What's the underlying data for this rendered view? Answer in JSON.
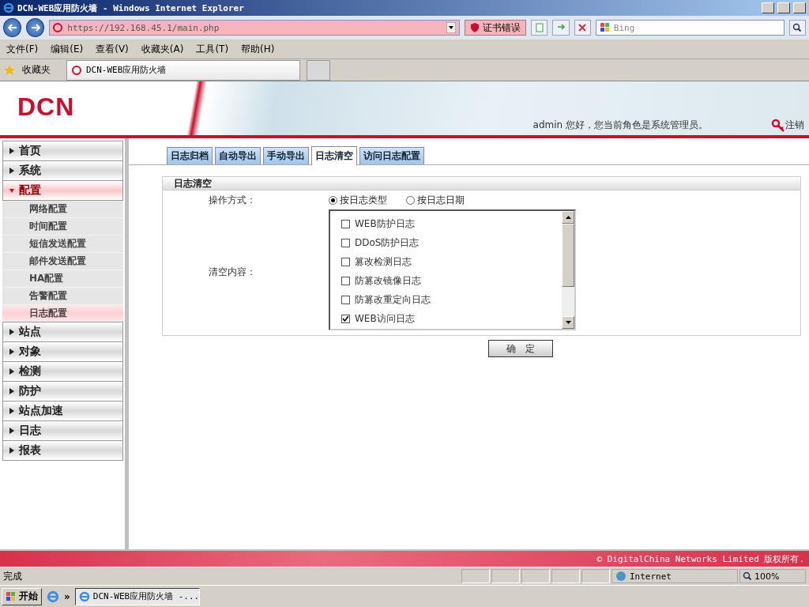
{
  "browser": {
    "title": "DCN-WEB应用防火墙 - Windows Internet Explorer",
    "address": "https://192.168.45.1/main.php",
    "cert_error": "证书错误",
    "search_placeholder": "Bing",
    "menu": [
      "文件(F)",
      "编辑(E)",
      "查看(V)",
      "收藏夹(A)",
      "工具(T)",
      "帮助(H)"
    ],
    "favorites": "收藏夹",
    "tab_title": "DCN-WEB应用防火墙"
  },
  "header": {
    "logo": "DCN",
    "greeting": "admin 您好，您当前角色是系统管理员。",
    "logout": "注销"
  },
  "sidebar": {
    "items": [
      {
        "label": "首页",
        "expanded": false
      },
      {
        "label": "系统",
        "expanded": false
      },
      {
        "label": "配置",
        "expanded": true,
        "children": [
          {
            "label": "网络配置",
            "selected": false
          },
          {
            "label": "时间配置",
            "selected": false
          },
          {
            "label": "短信发送配置",
            "selected": false
          },
          {
            "label": "邮件发送配置",
            "selected": false
          },
          {
            "label": "HA配置",
            "selected": false
          },
          {
            "label": "告警配置",
            "selected": false
          },
          {
            "label": "日志配置",
            "selected": true
          }
        ]
      },
      {
        "label": "站点",
        "expanded": false
      },
      {
        "label": "对象",
        "expanded": false
      },
      {
        "label": "检测",
        "expanded": false
      },
      {
        "label": "防护",
        "expanded": false
      },
      {
        "label": "站点加速",
        "expanded": false
      },
      {
        "label": "日志",
        "expanded": false
      },
      {
        "label": "报表",
        "expanded": false
      }
    ]
  },
  "tabs": [
    {
      "label": "日志归档",
      "selected": false
    },
    {
      "label": "自动导出",
      "selected": false
    },
    {
      "label": "手动导出",
      "selected": false
    },
    {
      "label": "日志清空",
      "selected": true
    },
    {
      "label": "访问日志配置",
      "selected": false
    }
  ],
  "panel": {
    "title": "日志清空",
    "operation_label": "操作方式：",
    "modes": [
      {
        "label": "按日志类型",
        "selected": true
      },
      {
        "label": "按日志日期",
        "selected": false
      }
    ],
    "content_label": "清空内容：",
    "log_types": [
      {
        "label": "WEB防护日志",
        "checked": false
      },
      {
        "label": "DDoS防护日志",
        "checked": false
      },
      {
        "label": "篡改检测日志",
        "checked": false
      },
      {
        "label": "防篡改镜像日志",
        "checked": false
      },
      {
        "label": "防篡改重定向日志",
        "checked": false
      },
      {
        "label": "WEB访问日志",
        "checked": true
      }
    ],
    "submit": "确　定"
  },
  "footer": {
    "copyright": "© DigitalChina Networks Limited 版权所有."
  },
  "status_bar": {
    "text": "完成",
    "zone": "Internet",
    "zoom": "100%"
  },
  "taskbar": {
    "start": "开始",
    "more": "»",
    "task": "DCN-WEB应用防火墙 -..."
  }
}
